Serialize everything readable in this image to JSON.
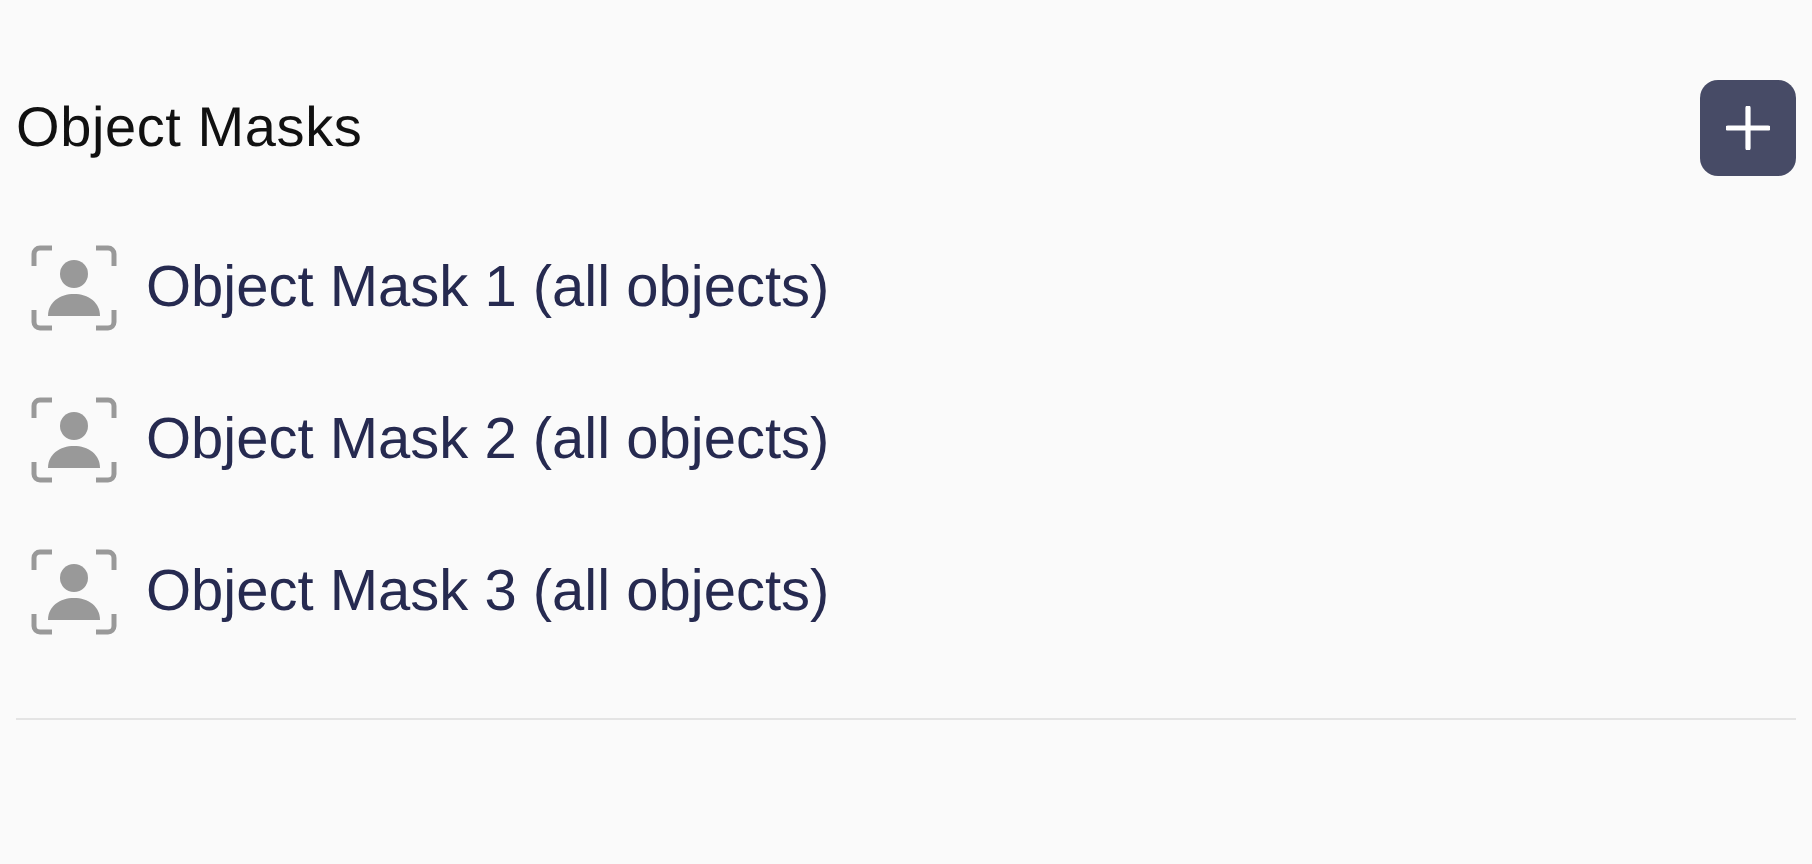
{
  "section": {
    "title": "Object Masks"
  },
  "masks": [
    {
      "label": "Object Mask 1 (all objects)"
    },
    {
      "label": "Object Mask 2 (all objects)"
    },
    {
      "label": "Object Mask 3 (all objects)"
    }
  ]
}
